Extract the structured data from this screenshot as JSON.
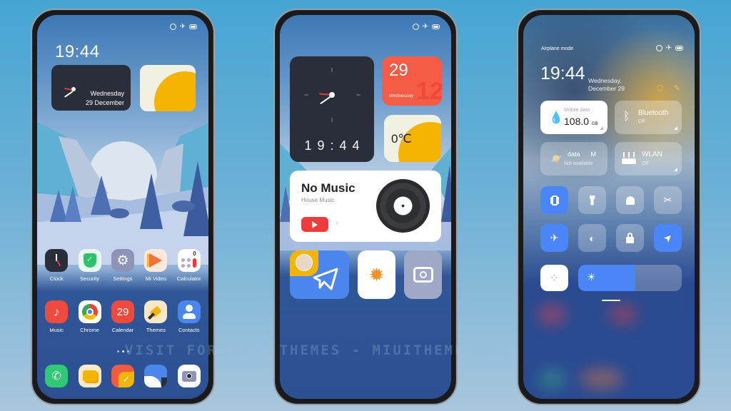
{
  "status_bar": {
    "icons": [
      "alarm-icon",
      "airplane-icon",
      "battery-icon"
    ]
  },
  "phone1": {
    "time": "19:44",
    "clock_widget": {
      "day": "Wednesday",
      "date": "29 December"
    },
    "weather_widget": {
      "icon": "sun-icon"
    },
    "apps_row1": [
      {
        "label": "Clock",
        "icon": "clock-icon",
        "color": "#2a2e3b"
      },
      {
        "label": "Security",
        "icon": "shield-check-icon",
        "color": "#2dc36a"
      },
      {
        "label": "Settings",
        "icon": "gear-icon",
        "color": "#8e94b8"
      },
      {
        "label": "Mi Video",
        "icon": "play-icon",
        "color": "#f57a3a"
      },
      {
        "label": "Calculator",
        "icon": "calculator-icon",
        "color": "#ffffff"
      }
    ],
    "apps_row2": [
      {
        "label": "Music",
        "icon": "music-note-icon",
        "color": "#f04a3e"
      },
      {
        "label": "Chrome",
        "icon": "chrome-icon",
        "color": "#ffffff"
      },
      {
        "label": "Calendar",
        "icon": "calendar-icon",
        "color": "#f04a3e",
        "text": "29"
      },
      {
        "label": "Themes",
        "icon": "brush-icon",
        "color": "#fbe6c6"
      },
      {
        "label": "Contacts",
        "icon": "person-icon",
        "color": "#4a86ee"
      }
    ],
    "calculator_badge": "0",
    "page_dots": {
      "count": 3,
      "active": 2
    },
    "dock": [
      {
        "name": "phone",
        "icon": "phone-icon",
        "color": "#2fc874"
      },
      {
        "name": "messages",
        "icon": "message-icon",
        "color": "#fdebc8"
      },
      {
        "name": "notes",
        "icon": "notes-check-icon",
        "color": "#f05a3e"
      },
      {
        "name": "gallery",
        "icon": "gallery-icon",
        "color": "#4a86ee"
      },
      {
        "name": "camera",
        "icon": "camera-icon",
        "color": "#ffffff"
      }
    ]
  },
  "phone2": {
    "clock_widget": {
      "digital": "19:44"
    },
    "calendar_widget": {
      "day": "29",
      "weekday": "Wednesday",
      "month_bg": "12"
    },
    "weather_widget": {
      "temperature": "0℃"
    },
    "music_widget": {
      "title": "No Music",
      "subtitle": "House Music",
      "play_button": "youtube-play-icon",
      "chevron": "›"
    },
    "tiles": [
      {
        "name": "telegram",
        "icon": "paper-plane-icon"
      },
      {
        "name": "weather",
        "icon": "sun-icon",
        "glyph": "✹"
      },
      {
        "name": "camera",
        "icon": "camera-icon"
      }
    ]
  },
  "phone3": {
    "mode_label": "Airplane mode",
    "time": "19:44",
    "date_line1": "Wednesday,",
    "date_line2": "December 29",
    "actions": [
      {
        "icon": "settings-hex-icon",
        "glyph": "⬡"
      },
      {
        "icon": "edit-icon",
        "glyph": "✎"
      }
    ],
    "big_tiles": [
      {
        "name": "mobile-data",
        "label": "Mobile data",
        "value": "108.0",
        "unit": "GB",
        "icon": "water-drop-icon",
        "active": true
      },
      {
        "name": "bluetooth",
        "label": "Bluetooth",
        "value": "Off",
        "icon": "bluetooth-icon",
        "active": false
      },
      {
        "name": "data",
        "label": "data",
        "label_extra": "M",
        "value": "Not available",
        "icon": "planet-icon",
        "active": false
      },
      {
        "name": "wlan",
        "label": "WLAN",
        "value": "Off",
        "icon": "router-icon",
        "active": false
      }
    ],
    "toggles_row1": [
      {
        "name": "vibrate",
        "icon": "vibrate-icon",
        "glyph": "📳",
        "state": "on"
      },
      {
        "name": "flashlight",
        "icon": "flashlight-icon",
        "glyph": "🔦",
        "state": "off"
      },
      {
        "name": "ringer",
        "icon": "bell-icon",
        "glyph": "🔔",
        "state": "off"
      },
      {
        "name": "screenshot",
        "icon": "scissors-screenshot-icon",
        "glyph": "✂",
        "state": "off"
      }
    ],
    "toggles_row2": [
      {
        "name": "airplane",
        "icon": "airplane-icon",
        "glyph": "✈",
        "state": "on"
      },
      {
        "name": "dark-mode",
        "icon": "contrast-icon",
        "glyph": "◐",
        "state": "off"
      },
      {
        "name": "lock",
        "icon": "lock-icon",
        "glyph": "🔒",
        "state": "off"
      },
      {
        "name": "location",
        "icon": "location-arrow-icon",
        "glyph": "➤",
        "state": "on"
      }
    ],
    "auto_brightness": {
      "icon": "loading-dots-icon",
      "glyph": "⁘"
    },
    "brightness": {
      "value_percent": 55,
      "icon": "sun-icon",
      "glyph": "☀"
    }
  },
  "watermark": "VISIT FOR MORE THEMES - MIUITHEMER.COM"
}
